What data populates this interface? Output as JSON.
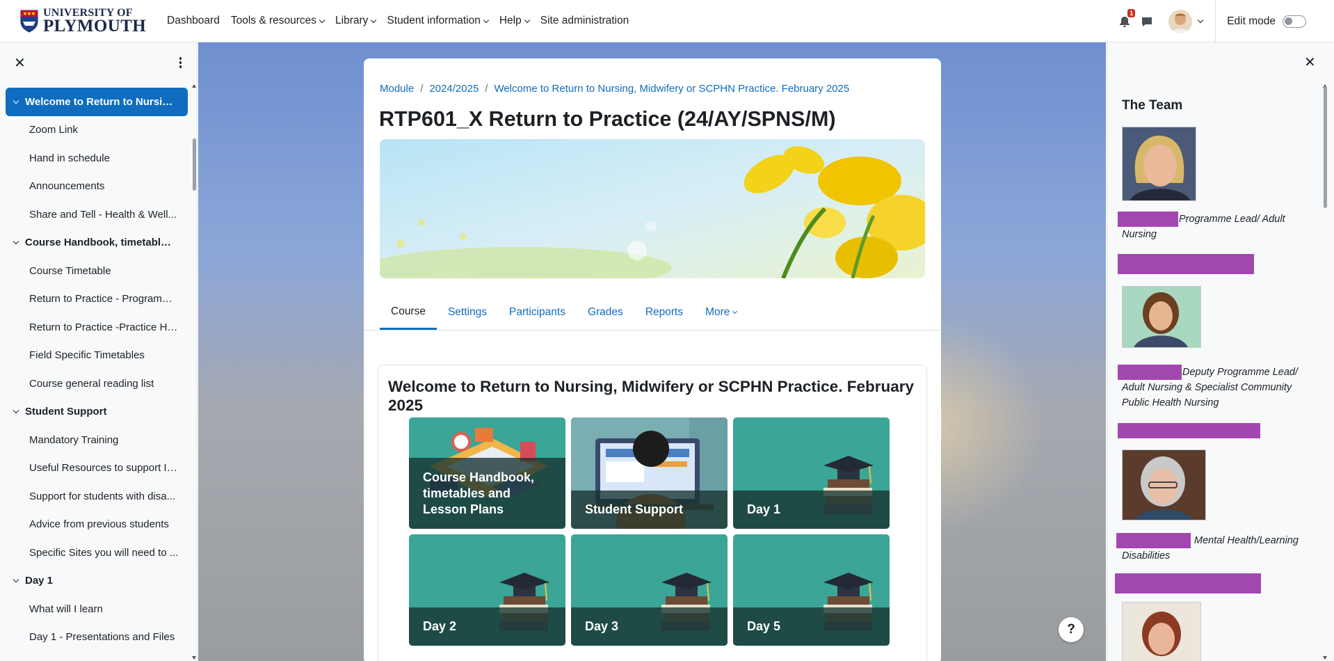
{
  "brand": {
    "line1": "UNIVERSITY OF",
    "line2": "PLYMOUTH"
  },
  "nav": {
    "items": [
      {
        "label": "Dashboard",
        "dropdown": false
      },
      {
        "label": "Tools & resources",
        "dropdown": true
      },
      {
        "label": "Library",
        "dropdown": true
      },
      {
        "label": "Student information",
        "dropdown": true
      },
      {
        "label": "Help",
        "dropdown": true
      },
      {
        "label": "Site administration",
        "dropdown": false
      }
    ],
    "notification_count": "1",
    "edit_mode_label": "Edit mode",
    "edit_mode_on": false
  },
  "course_index": {
    "items": [
      {
        "type": "section",
        "label": "Welcome to Return to Nursin...",
        "active": true
      },
      {
        "type": "item",
        "label": "Zoom Link"
      },
      {
        "type": "item",
        "label": "Hand in schedule"
      },
      {
        "type": "item",
        "label": "Announcements"
      },
      {
        "type": "item",
        "label": "Share and Tell - Health & Well..."
      },
      {
        "type": "section",
        "label": "Course Handbook, timetable..."
      },
      {
        "type": "item",
        "label": "Course Timetable"
      },
      {
        "type": "item",
        "label": "Return to Practice - Programm..."
      },
      {
        "type": "item",
        "label": "Return to Practice -Practice Ha..."
      },
      {
        "type": "item",
        "label": "Field Specific Timetables"
      },
      {
        "type": "item",
        "label": "Course general reading list"
      },
      {
        "type": "section",
        "label": "Student Support"
      },
      {
        "type": "item",
        "label": "Mandatory Training"
      },
      {
        "type": "item",
        "label": "Useful Resources to support IT ..."
      },
      {
        "type": "item",
        "label": "Support for students with disa..."
      },
      {
        "type": "item",
        "label": "Advice from previous students"
      },
      {
        "type": "item",
        "label": "Specific Sites you will need to ..."
      },
      {
        "type": "section",
        "label": "Day 1"
      },
      {
        "type": "item",
        "label": "What will I learn"
      },
      {
        "type": "item",
        "label": "Day 1 - Presentations and Files"
      }
    ]
  },
  "breadcrumb": [
    "Module",
    "2024/2025",
    "Welcome to Return to Nursing, Midwifery or SCPHN Practice. February 2025"
  ],
  "page_title": "RTP601_X Return to Practice (24/AY/SPNS/M)",
  "tabs": [
    {
      "label": "Course",
      "active": true
    },
    {
      "label": "Settings"
    },
    {
      "label": "Participants"
    },
    {
      "label": "Grades"
    },
    {
      "label": "Reports"
    },
    {
      "label": "More",
      "dropdown": true
    }
  ],
  "section": {
    "title": "Welcome to Return to Nursing, Midwifery or SCPHN Practice. February 2025",
    "tiles": [
      {
        "label": "Course Handbook, timetables and Lesson Plans",
        "image": "isometric-desk-icon"
      },
      {
        "label": "Student Support",
        "image": "student-computer-icon"
      },
      {
        "label": "Day 1",
        "image": "graduation-books-icon"
      },
      {
        "label": "Day 2",
        "image": "graduation-books-icon"
      },
      {
        "label": "Day 3",
        "image": "graduation-books-icon"
      },
      {
        "label": "Day 5",
        "image": "graduation-books-icon"
      }
    ]
  },
  "team": {
    "title": "The Team",
    "members": [
      {
        "role": "Programme Lead/ Adult Nursing"
      },
      {
        "role": "Deputy Programme Lead/ Adult Nursing & Specialist Community Public Health Nursing"
      },
      {
        "role": "Mental Health/Learning Disabilities"
      },
      {
        "role": ""
      }
    ]
  },
  "help_label": "?",
  "colors": {
    "accent": "#0f6cbf",
    "tile": "#3ba597",
    "redaction": "#a347b0"
  }
}
